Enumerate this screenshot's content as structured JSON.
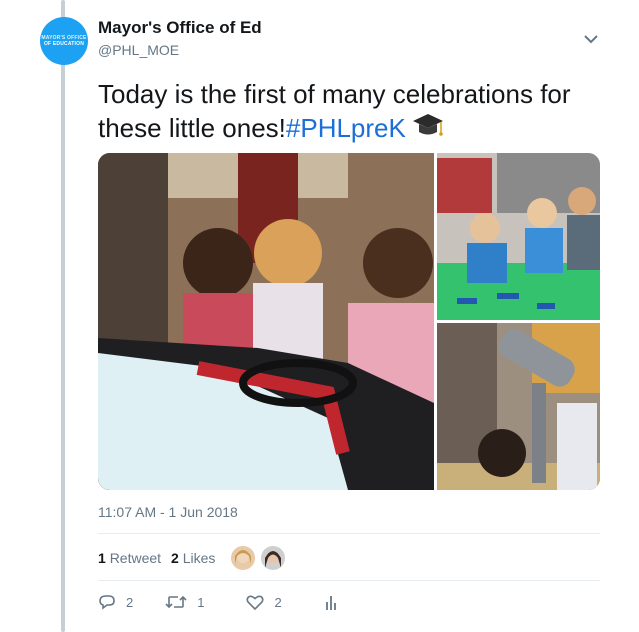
{
  "author": {
    "display_name": "Mayor's Office of Ed",
    "handle": "@PHL_MOE",
    "avatar_text_line1": "MAYOR'S OFFICE",
    "avatar_text_line2": "OF EDUCATION"
  },
  "tweet": {
    "text_main": "Today is the first of many celebrations for these little ones!",
    "hashtag": "#PHLpreK",
    "emoji_icon": "graduation-cap-icon"
  },
  "timestamp": "11:07 AM - 1 Jun 2018",
  "stats": {
    "retweet_count": "1",
    "retweet_label": "Retweet",
    "like_count": "2",
    "like_label": "Likes"
  },
  "actions": {
    "reply_count": "2",
    "retweet_count": "1",
    "like_count": "2"
  },
  "colors": {
    "accent": "#1da1f2",
    "hashtag": "#1b6fd6",
    "muted": "#657786",
    "thread_line": "#c4cfd6"
  }
}
